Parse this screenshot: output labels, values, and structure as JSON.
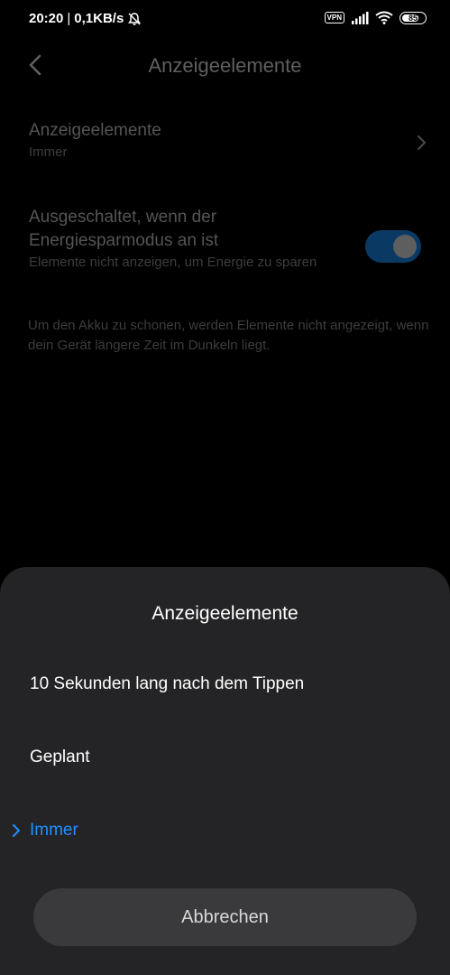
{
  "status_bar": {
    "time": "20:20",
    "separator": "|",
    "network_speed": "0,1KB/s",
    "vpn_label": "VPN",
    "battery_level": "85"
  },
  "header": {
    "title": "Anzeigeelemente"
  },
  "settings": {
    "row1": {
      "title": "Anzeigeelemente",
      "value": "Immer"
    },
    "row2": {
      "title": "Ausgeschaltet, wenn der Energiesparmodus an ist",
      "subtitle": "Elemente nicht anzeigen, um Energie zu sparen",
      "toggle_on": true
    },
    "info": "Um den Akku zu schonen, werden Elemente nicht angezeigt, wenn dein Gerät längere Zeit im Dunkeln liegt."
  },
  "sheet": {
    "title": "Anzeigeelemente",
    "options": [
      "10 Sekunden lang nach dem Tippen",
      "Geplant",
      "Immer"
    ],
    "selected_index": 2,
    "cancel_label": "Abbrechen"
  },
  "colors": {
    "accent": "#1e90ff",
    "sheet_bg": "#242426",
    "button_bg": "#3a3a3c"
  }
}
